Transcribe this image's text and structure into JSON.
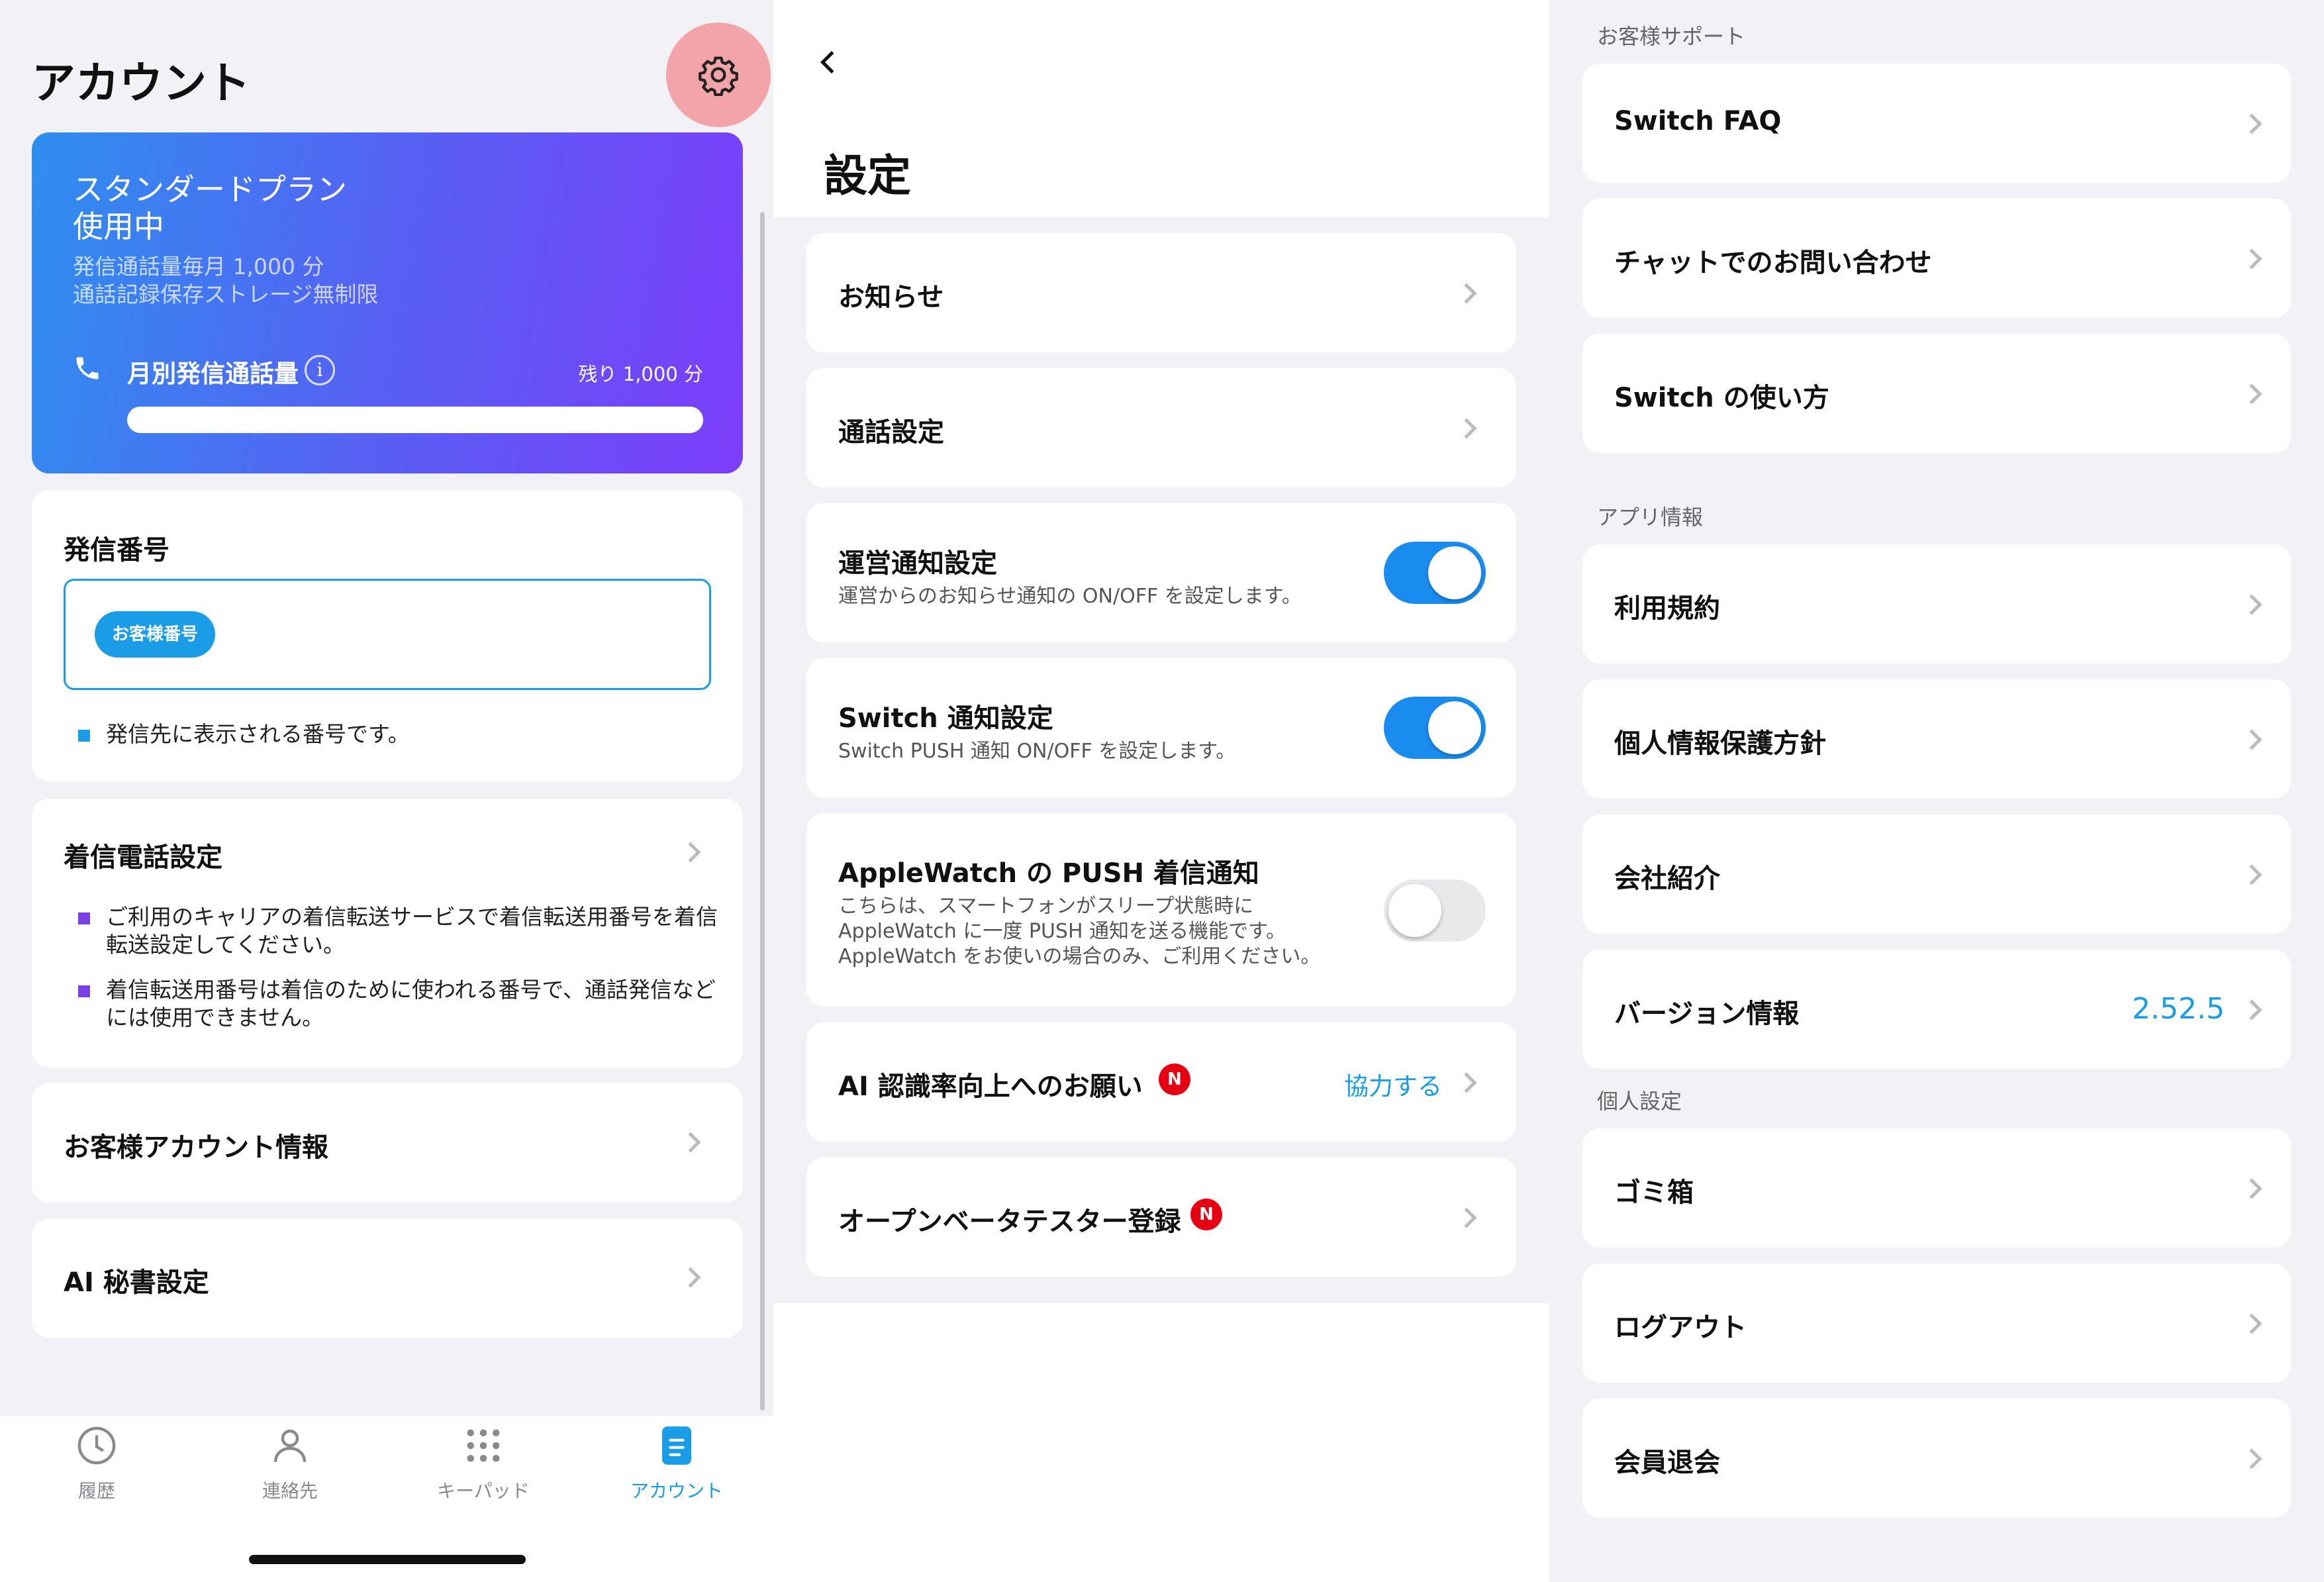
{
  "account": {
    "title": "アカウント",
    "settings_icon": "gear-icon",
    "plan": {
      "name": "スタンダードプラン",
      "status": "使用中",
      "detail1": "発信通話量毎月 1,000 分",
      "detail2": "通話記録保存ストレージ無制限",
      "usage_label": "月別発信通話量",
      "remaining": "残り 1,000 分",
      "usage_fraction": 1.0
    },
    "caller_number": {
      "title": "発信番号",
      "tag": "お客様番号",
      "note": "発信先に表示される番号です。"
    },
    "incoming": {
      "title": "着信電話設定",
      "note1": "ご利用のキャリアの着信転送サービスで着信転送用番号を着信転送設定してください。",
      "note2": "着信転送用番号は着信のために使われる番号で、通話発信などには使用できません。"
    },
    "customer_info": "お客様アカウント情報",
    "ai_secretary": "AI 秘書設定",
    "tabs": [
      {
        "label": "履歴",
        "icon": "clock-icon",
        "active": false
      },
      {
        "label": "連絡先",
        "icon": "person-icon",
        "active": false
      },
      {
        "label": "キーパッド",
        "icon": "keypad-icon",
        "active": false
      },
      {
        "label": "アカウント",
        "icon": "account-doc-icon",
        "active": true
      }
    ]
  },
  "settings": {
    "back_icon": "chevron-left-icon",
    "title": "設定",
    "notice": "お知らせ",
    "call_settings": "通話設定",
    "ops_notify": {
      "title": "運営通知設定",
      "desc": "運営からのお知らせ通知の ON/OFF を設定します。",
      "on": true
    },
    "switch_notify": {
      "title": "Switch 通知設定",
      "desc": "Switch PUSH 通知 ON/OFF を設定します。",
      "on": true
    },
    "applewatch": {
      "title": "AppleWatch の PUSH 着信通知",
      "desc1": "こちらは、スマートフォンがスリープ状態時に",
      "desc2": "AppleWatch に一度 PUSH 通知を送る機能です。",
      "desc3": "AppleWatch をお使いの場合のみ、ご利用ください。",
      "on": false
    },
    "ai_recognition": {
      "title": "AI 認識率向上へのお願い",
      "badge": "N",
      "action": "協力する"
    },
    "open_beta": {
      "title": "オープンベータテスター登録",
      "badge": "N"
    }
  },
  "more": {
    "support_header": "お客様サポート",
    "faq": "Switch FAQ",
    "chat": "チャットでのお問い合わせ",
    "howto": "Switch の使い方",
    "app_header": "アプリ情報",
    "terms": "利用規約",
    "privacy": "個人情報保護方針",
    "company": "会社紹介",
    "version_label": "バージョン情報",
    "version_value": "2.52.5",
    "personal_header": "個人設定",
    "trash": "ゴミ箱",
    "logout": "ログアウト",
    "withdraw": "会員退会"
  },
  "colors": {
    "accent": "#1a9de6",
    "toggle_on": "#1a8cf0",
    "badge": "#e50012",
    "bullet_blue": "#1a9de6",
    "bullet_purple": "#7b3fe4",
    "gear_bg": "#f3a4a8"
  }
}
